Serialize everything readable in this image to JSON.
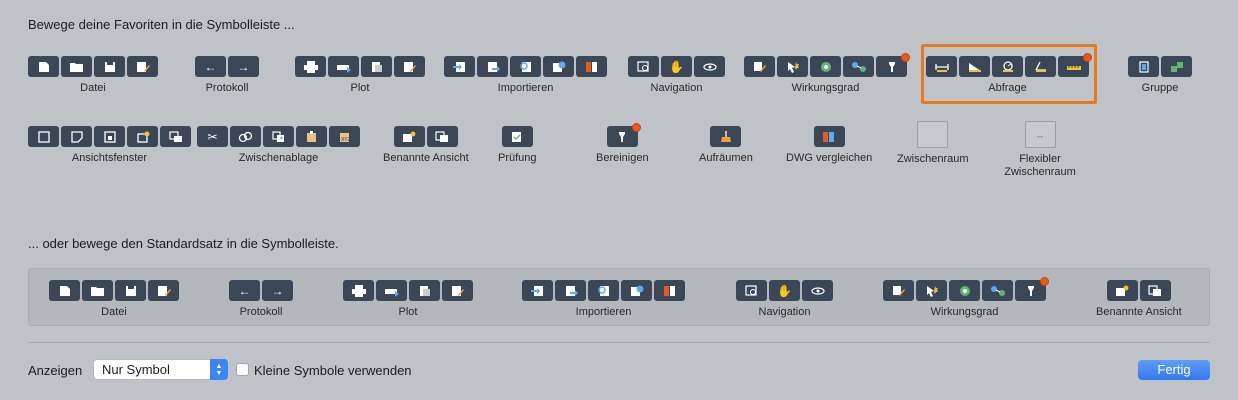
{
  "headings": {
    "favorites": "Bewege deine Favoriten in die Symbolleiste ...",
    "default_set": "... oder bewege den Standardsatz in die Symbolleiste."
  },
  "favorites_row1": [
    {
      "label": "Datei",
      "icons": [
        "new-file-icon",
        "open-folder-icon",
        "save-icon",
        "save-as-icon"
      ]
    },
    {
      "label": "Protokoll",
      "icons": [
        "undo-icon",
        "redo-icon"
      ]
    },
    {
      "label": "Plot",
      "icons": [
        "print-icon",
        "plot-icon",
        "page-setup-icon",
        "publish-icon"
      ]
    },
    {
      "label": "Importieren",
      "icons": [
        "import-icon",
        "attach-icon",
        "attach-pdf-icon",
        "attach-image-icon",
        "attach-dwg-icon"
      ]
    },
    {
      "label": "Navigation",
      "icons": [
        "zoom-window-icon",
        "pan-hand-icon",
        "orbit-icon"
      ]
    },
    {
      "label": "Wirkungsgrad",
      "icons": [
        "match-properties-icon",
        "quick-select-icon",
        "isolate-icon",
        "layer-state-icon",
        "purge-icon"
      ]
    },
    {
      "label": "Abfrage",
      "icons": [
        "distance-icon",
        "area-icon",
        "radius-icon",
        "angle-icon",
        "measure-icon"
      ]
    },
    {
      "label": "Gruppe",
      "icons": [
        "group-icon",
        "ungroup-icon"
      ]
    }
  ],
  "favorites_row2": [
    {
      "label": "Ansichtsfenster",
      "icons": [
        "viewport-icon",
        "viewport-clip-icon",
        "viewport-lock-icon",
        "new-viewport-icon",
        "named-viewport-icon"
      ]
    },
    {
      "label": "Zwischenablage",
      "icons": [
        "cut-icon",
        "copy-icon",
        "copy-base-icon",
        "paste-icon",
        "paste-special-icon"
      ]
    },
    {
      "label": "Benannte Ansicht",
      "icons": [
        "named-view-icon",
        "view-manager-icon"
      ]
    },
    {
      "label": "Prüfung",
      "icons": [
        "audit-icon"
      ]
    },
    {
      "label": "Bereinigen",
      "icons": [
        "purge-all-icon"
      ]
    },
    {
      "label": "Aufräumen",
      "icons": [
        "cleanup-broom-icon"
      ]
    },
    {
      "label": "DWG vergleichen",
      "icons": [
        "dwg-compare-icon"
      ]
    },
    {
      "label": "Zwischenraum",
      "icons": []
    },
    {
      "label": "Flexibler Zwischenraum",
      "icons": []
    }
  ],
  "default_row": [
    {
      "label": "Datei"
    },
    {
      "label": "Protokoll"
    },
    {
      "label": "Plot"
    },
    {
      "label": "Importieren"
    },
    {
      "label": "Navigation"
    },
    {
      "label": "Wirkungsgrad"
    },
    {
      "label": "Benannte Ansicht"
    }
  ],
  "footer": {
    "show_label": "Anzeigen",
    "show_value": "Nur Symbol",
    "small_icons_label": "Kleine Symbole verwenden",
    "done_label": "Fertig"
  },
  "colors": {
    "background": "#bfc2c6",
    "button": "#3b4656",
    "highlight": "#e8791c",
    "accent": "#3379f0",
    "badge": "#e85a1c"
  }
}
